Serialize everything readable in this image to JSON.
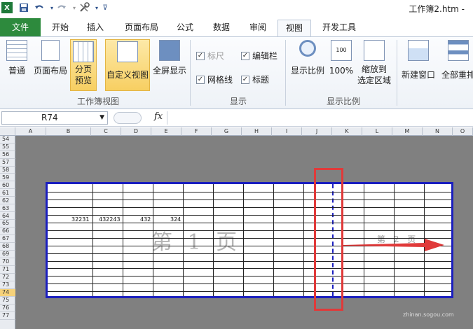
{
  "app": {
    "doc_title": "工作簿2.htm -"
  },
  "quick_access": {
    "icons": [
      "excel-logo-icon",
      "save-icon",
      "undo-icon",
      "redo-icon",
      "tools-icon",
      "dropdown-icon"
    ]
  },
  "tabs": [
    "文件",
    "开始",
    "插入",
    "页面布局",
    "公式",
    "数据",
    "审阅",
    "视图",
    "开发工具"
  ],
  "active_tab": "视图",
  "ribbon": {
    "workbook_views": {
      "label": "工作簿视图",
      "buttons": [
        {
          "label": "普通"
        },
        {
          "label": "页面布局"
        },
        {
          "label": "分页\n预览",
          "label_line1": "分页",
          "label_line2": "预览",
          "selected": true
        },
        {
          "label": "自定义视图",
          "selected": true
        },
        {
          "label": "全屏显示"
        }
      ]
    },
    "show": {
      "label": "显示",
      "checkboxes": [
        {
          "label": "标尺",
          "checked": true,
          "disabled": true
        },
        {
          "label": "编辑栏",
          "checked": true
        },
        {
          "label": "网格线",
          "checked": true
        },
        {
          "label": "标题",
          "checked": true
        }
      ]
    },
    "zoom": {
      "label": "显示比例",
      "buttons": [
        {
          "label": "显示比例"
        },
        {
          "label": "100%"
        },
        {
          "label_line1": "缩放到",
          "label_line2": "选定区域"
        }
      ]
    },
    "window": {
      "buttons": [
        {
          "label": "新建窗口"
        },
        {
          "label": "全部重排"
        }
      ]
    }
  },
  "formula_bar": {
    "name_box": "R74",
    "fx_label": "fx",
    "value": ""
  },
  "sheet": {
    "columns": [
      "A",
      "B",
      "C",
      "D",
      "E",
      "F",
      "G",
      "H",
      "I",
      "J",
      "K",
      "L",
      "M",
      "N",
      "O"
    ],
    "rows": [
      "54",
      "55",
      "56",
      "57",
      "58",
      "59",
      "60",
      "61",
      "62",
      "63",
      "64",
      "65",
      "66",
      "67",
      "68",
      "69",
      "70",
      "71",
      "72",
      "73",
      "74",
      "75",
      "76",
      "77"
    ],
    "active_row": "74",
    "cells": [
      {
        "ref": "B64",
        "value": "32231"
      },
      {
        "ref": "C64",
        "value": "432243"
      },
      {
        "ref": "D64",
        "value": "432"
      },
      {
        "ref": "E64",
        "value": "324"
      }
    ],
    "page_labels": [
      "第 1 页",
      "第 2 页"
    ]
  },
  "colors": {
    "file_tab": "#2d8a3d",
    "page_border": "#1b1fbf",
    "highlight_box": "#e03a3a",
    "arrow": "#e03a3a"
  },
  "site_watermark": "zhinan.sogou.com"
}
